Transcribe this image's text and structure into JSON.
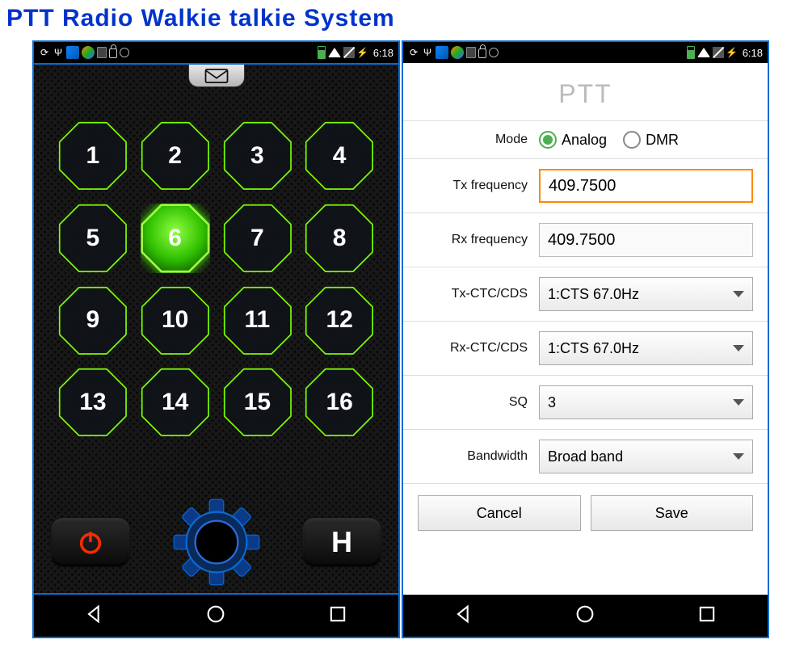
{
  "page_title": "PTT Radio Walkie talkie System",
  "statusbar": {
    "time": "6:18"
  },
  "keypad": {
    "channels": [
      "1",
      "2",
      "3",
      "4",
      "5",
      "6",
      "7",
      "8",
      "9",
      "10",
      "11",
      "12",
      "13",
      "14",
      "15",
      "16"
    ],
    "selected": 6,
    "h_label": "H"
  },
  "settings": {
    "title": "PTT",
    "mode_label": "Mode",
    "mode_analog": "Analog",
    "mode_dmr": "DMR",
    "tx_freq_label": "Tx frequency",
    "tx_freq_value": "409.7500",
    "rx_freq_label": "Rx frequency",
    "rx_freq_value": "409.7500",
    "tx_ctc_label": "Tx-CTC/CDS",
    "tx_ctc_value": "1:CTS 67.0Hz",
    "rx_ctc_label": "Rx-CTC/CDS",
    "rx_ctc_value": "1:CTS 67.0Hz",
    "sq_label": "SQ",
    "sq_value": "3",
    "bw_label": "Bandwidth",
    "bw_value": "Broad band",
    "cancel": "Cancel",
    "save": "Save"
  }
}
